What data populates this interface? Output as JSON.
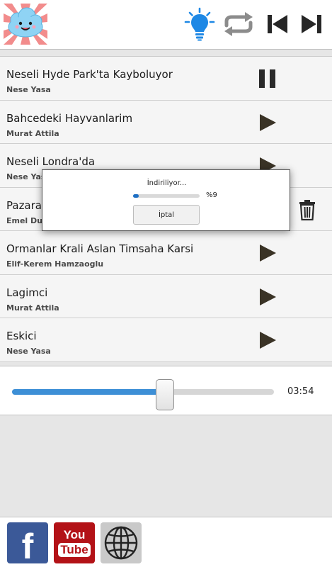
{
  "header": {
    "icons": [
      "cloud-logo",
      "lightbulb-icon",
      "repeat-icon",
      "previous-icon",
      "next-icon"
    ],
    "accent_color": "#1e88e5"
  },
  "songs": [
    {
      "title": "Neseli Hyde Park'ta Kayboluyor",
      "artist": "Nese Yasa",
      "state": "playing",
      "icon": "pause-icon"
    },
    {
      "title": "Bahcedeki Hayvanlarim",
      "artist": "Murat Attila",
      "state": "idle",
      "icon": "play-icon"
    },
    {
      "title": "Neseli Londra'da",
      "artist": "Nese Yasa",
      "state": "idle",
      "icon": "play-icon"
    },
    {
      "title": "Pazara",
      "artist": "Emel Dur",
      "state": "downloaded",
      "icon": "trash-icon"
    },
    {
      "title": "Ormanlar Krali Aslan Timsaha Karsi",
      "artist": "Elif-Kerem Hamzaoglu",
      "state": "idle",
      "icon": "play-icon"
    },
    {
      "title": "Lagimci",
      "artist": "Murat Attila",
      "state": "idle",
      "icon": "play-icon"
    },
    {
      "title": "Eskici",
      "artist": "Nese Yasa",
      "state": "idle",
      "icon": "play-icon"
    }
  ],
  "player": {
    "progress_fraction": 0.583,
    "time": "03:54",
    "fill_color": "#3d8fd6"
  },
  "dialog": {
    "title": "İndiriliyor...",
    "percent_text": "%9",
    "percent_value": 9,
    "cancel_label": "İptal"
  },
  "footer": {
    "links": [
      {
        "name": "facebook",
        "color": "#3b5998",
        "text": "f"
      },
      {
        "name": "youtube",
        "color": "#b31217",
        "line1": "You",
        "line2": "Tube"
      },
      {
        "name": "web",
        "color": "#c9c9c9"
      }
    ]
  }
}
